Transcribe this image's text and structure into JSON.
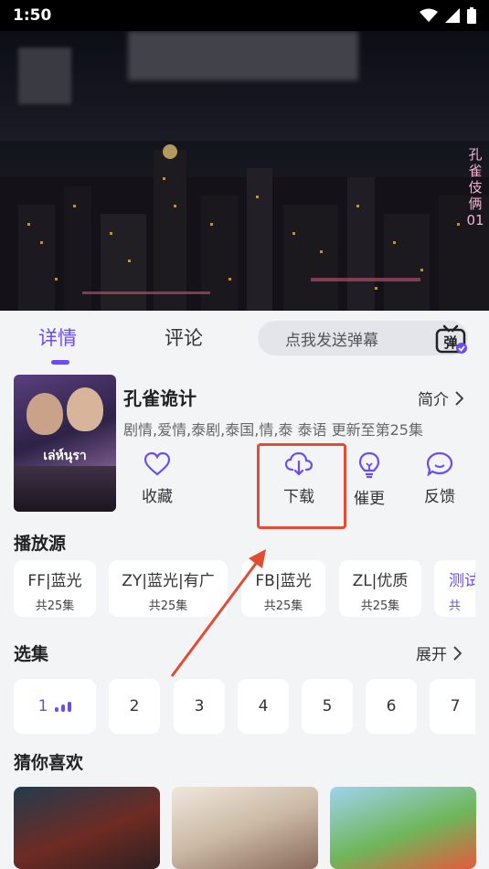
{
  "status_bar": {
    "time": "1:50"
  },
  "video": {
    "overlay_title": "孔雀伎俩01"
  },
  "tabs": {
    "detail": "详情",
    "comments": "评论"
  },
  "danmaku": {
    "placeholder": "点我发送弹幕",
    "icon_text": "弹"
  },
  "show": {
    "poster_title": "เล่ห์นุรา",
    "title": "孔雀诡计",
    "intro_label": "简介",
    "meta": "剧情,爱情,泰剧,泰国,情,泰 泰语 更新至第25集"
  },
  "actions": {
    "favorite": "收藏",
    "download": "下载",
    "urge": "催更",
    "feedback": "反馈"
  },
  "sources_title": "播放源",
  "sources": [
    {
      "name": "FF|蓝光",
      "count": "共25集"
    },
    {
      "name": "ZY|蓝光|有广",
      "count": "共25集"
    },
    {
      "name": "FB|蓝光",
      "count": "共25集"
    },
    {
      "name": "ZL|优质",
      "count": "共25集"
    },
    {
      "name": "测试",
      "count": "共"
    }
  ],
  "episodes_title": "选集",
  "expand_label": "展开",
  "episodes": [
    "1",
    "2",
    "3",
    "4",
    "5",
    "6",
    "7"
  ],
  "recommend_title": "猜你喜欢",
  "colors": {
    "accent": "#6b4cf0",
    "highlight": "#e44b35"
  }
}
